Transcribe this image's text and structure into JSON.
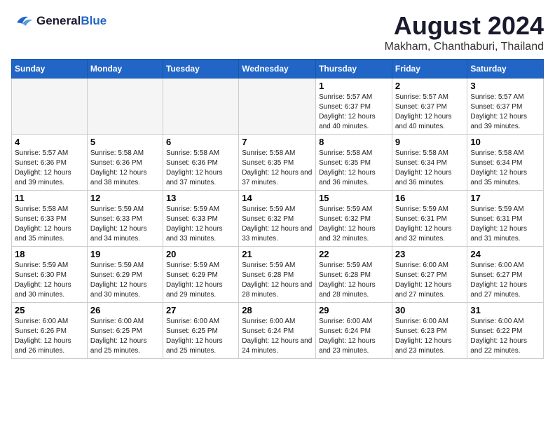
{
  "header": {
    "logo_line1": "General",
    "logo_line2": "Blue",
    "month_title": "August 2024",
    "location": "Makham, Chanthaburi, Thailand"
  },
  "days_of_week": [
    "Sunday",
    "Monday",
    "Tuesday",
    "Wednesday",
    "Thursday",
    "Friday",
    "Saturday"
  ],
  "weeks": [
    [
      {
        "day": "",
        "empty": true
      },
      {
        "day": "",
        "empty": true
      },
      {
        "day": "",
        "empty": true
      },
      {
        "day": "",
        "empty": true
      },
      {
        "day": "1",
        "sunrise": "5:57 AM",
        "sunset": "6:37 PM",
        "daylight": "12 hours and 40 minutes."
      },
      {
        "day": "2",
        "sunrise": "5:57 AM",
        "sunset": "6:37 PM",
        "daylight": "12 hours and 40 minutes."
      },
      {
        "day": "3",
        "sunrise": "5:57 AM",
        "sunset": "6:37 PM",
        "daylight": "12 hours and 39 minutes."
      }
    ],
    [
      {
        "day": "4",
        "sunrise": "5:57 AM",
        "sunset": "6:36 PM",
        "daylight": "12 hours and 39 minutes."
      },
      {
        "day": "5",
        "sunrise": "5:58 AM",
        "sunset": "6:36 PM",
        "daylight": "12 hours and 38 minutes."
      },
      {
        "day": "6",
        "sunrise": "5:58 AM",
        "sunset": "6:36 PM",
        "daylight": "12 hours and 37 minutes."
      },
      {
        "day": "7",
        "sunrise": "5:58 AM",
        "sunset": "6:35 PM",
        "daylight": "12 hours and 37 minutes."
      },
      {
        "day": "8",
        "sunrise": "5:58 AM",
        "sunset": "6:35 PM",
        "daylight": "12 hours and 36 minutes."
      },
      {
        "day": "9",
        "sunrise": "5:58 AM",
        "sunset": "6:34 PM",
        "daylight": "12 hours and 36 minutes."
      },
      {
        "day": "10",
        "sunrise": "5:58 AM",
        "sunset": "6:34 PM",
        "daylight": "12 hours and 35 minutes."
      }
    ],
    [
      {
        "day": "11",
        "sunrise": "5:58 AM",
        "sunset": "6:33 PM",
        "daylight": "12 hours and 35 minutes."
      },
      {
        "day": "12",
        "sunrise": "5:59 AM",
        "sunset": "6:33 PM",
        "daylight": "12 hours and 34 minutes."
      },
      {
        "day": "13",
        "sunrise": "5:59 AM",
        "sunset": "6:33 PM",
        "daylight": "12 hours and 33 minutes."
      },
      {
        "day": "14",
        "sunrise": "5:59 AM",
        "sunset": "6:32 PM",
        "daylight": "12 hours and 33 minutes."
      },
      {
        "day": "15",
        "sunrise": "5:59 AM",
        "sunset": "6:32 PM",
        "daylight": "12 hours and 32 minutes."
      },
      {
        "day": "16",
        "sunrise": "5:59 AM",
        "sunset": "6:31 PM",
        "daylight": "12 hours and 32 minutes."
      },
      {
        "day": "17",
        "sunrise": "5:59 AM",
        "sunset": "6:31 PM",
        "daylight": "12 hours and 31 minutes."
      }
    ],
    [
      {
        "day": "18",
        "sunrise": "5:59 AM",
        "sunset": "6:30 PM",
        "daylight": "12 hours and 30 minutes."
      },
      {
        "day": "19",
        "sunrise": "5:59 AM",
        "sunset": "6:29 PM",
        "daylight": "12 hours and 30 minutes."
      },
      {
        "day": "20",
        "sunrise": "5:59 AM",
        "sunset": "6:29 PM",
        "daylight": "12 hours and 29 minutes."
      },
      {
        "day": "21",
        "sunrise": "5:59 AM",
        "sunset": "6:28 PM",
        "daylight": "12 hours and 28 minutes."
      },
      {
        "day": "22",
        "sunrise": "5:59 AM",
        "sunset": "6:28 PM",
        "daylight": "12 hours and 28 minutes."
      },
      {
        "day": "23",
        "sunrise": "6:00 AM",
        "sunset": "6:27 PM",
        "daylight": "12 hours and 27 minutes."
      },
      {
        "day": "24",
        "sunrise": "6:00 AM",
        "sunset": "6:27 PM",
        "daylight": "12 hours and 27 minutes."
      }
    ],
    [
      {
        "day": "25",
        "sunrise": "6:00 AM",
        "sunset": "6:26 PM",
        "daylight": "12 hours and 26 minutes."
      },
      {
        "day": "26",
        "sunrise": "6:00 AM",
        "sunset": "6:25 PM",
        "daylight": "12 hours and 25 minutes."
      },
      {
        "day": "27",
        "sunrise": "6:00 AM",
        "sunset": "6:25 PM",
        "daylight": "12 hours and 25 minutes."
      },
      {
        "day": "28",
        "sunrise": "6:00 AM",
        "sunset": "6:24 PM",
        "daylight": "12 hours and 24 minutes."
      },
      {
        "day": "29",
        "sunrise": "6:00 AM",
        "sunset": "6:24 PM",
        "daylight": "12 hours and 23 minutes."
      },
      {
        "day": "30",
        "sunrise": "6:00 AM",
        "sunset": "6:23 PM",
        "daylight": "12 hours and 23 minutes."
      },
      {
        "day": "31",
        "sunrise": "6:00 AM",
        "sunset": "6:22 PM",
        "daylight": "12 hours and 22 minutes."
      }
    ]
  ]
}
